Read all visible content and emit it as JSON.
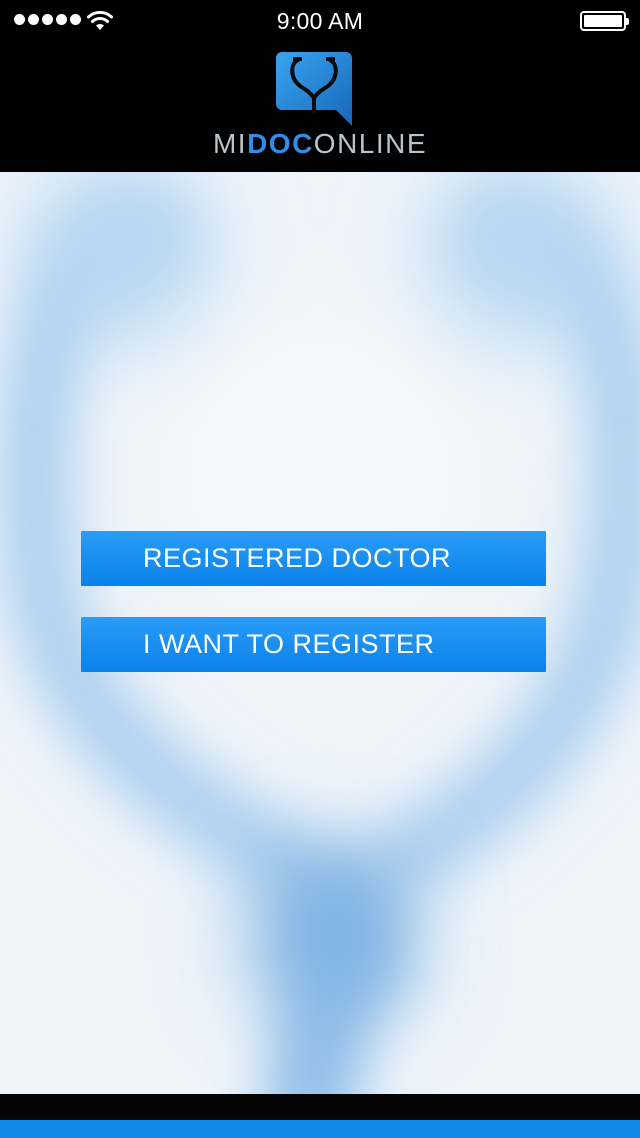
{
  "status_bar": {
    "time": "9:00 AM"
  },
  "brand": {
    "part1": "MI",
    "part2": "DOC",
    "part3": "ONLINE"
  },
  "buttons": {
    "registered_doctor": "REGISTERED DOCTOR",
    "want_to_register": "I WANT TO REGISTER"
  },
  "colors": {
    "accent": "#1488e6",
    "button": "#1a8df0",
    "background": "#edf3f9",
    "header": "#000000"
  },
  "icons": {
    "signal": "signal-strength-icon",
    "wifi": "wifi-icon",
    "battery": "battery-icon",
    "logo": "stethoscope-chat-logo-icon"
  }
}
